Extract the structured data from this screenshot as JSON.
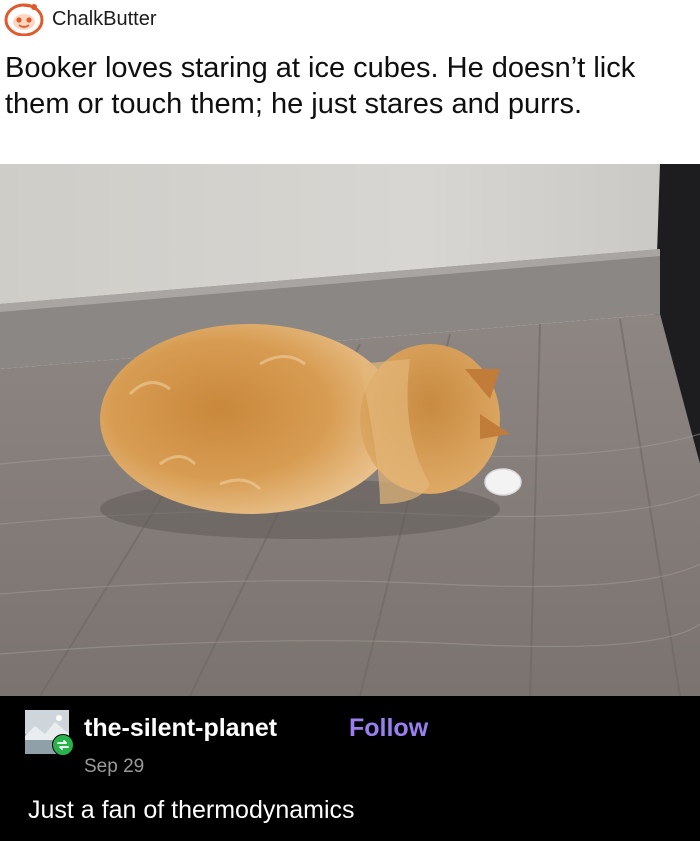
{
  "reddit_post": {
    "username": "ChalkButter",
    "avatar_icon": "reddit-snoo-avatar-icon",
    "text": "Booker loves staring at ice cubes. He doesn’t lick them or touch them; he just stares and purrs."
  },
  "photo": {
    "subject": "orange-cat-and-ice-cube-photo"
  },
  "tumblr_reply": {
    "username": "the-silent-planet",
    "follow_label": "Follow",
    "date": "Sep 29",
    "text": "Just a fan of thermodynamics",
    "avatar_icon": "landscape-avatar-icon",
    "badge_icon": "reblog-icon",
    "colors": {
      "background": "#000000",
      "follow": "#9b7ff0",
      "badge": "#27b24a"
    }
  }
}
